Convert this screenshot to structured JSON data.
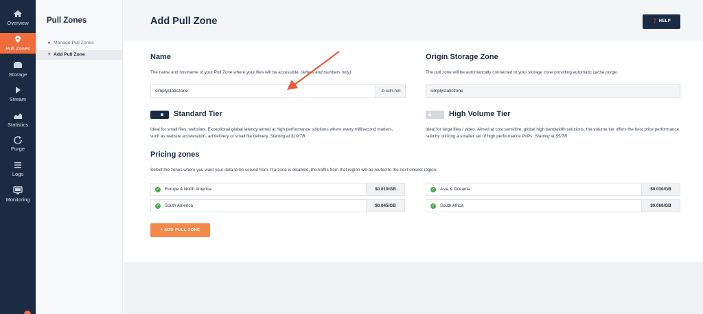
{
  "nav": {
    "items": [
      {
        "label": "Overview",
        "icon": "home-icon"
      },
      {
        "label": "Pull Zones",
        "icon": "map-pin-icon"
      },
      {
        "label": "Storage",
        "icon": "storage-icon"
      },
      {
        "label": "Stream",
        "icon": "play-icon"
      },
      {
        "label": "Statistics",
        "icon": "bar-chart-icon"
      },
      {
        "label": "Purge",
        "icon": "refresh-icon"
      },
      {
        "label": "Logs",
        "icon": "list-icon"
      },
      {
        "label": "Monitoring",
        "icon": "monitor-icon"
      }
    ],
    "active": "Pull Zones"
  },
  "sidebar": {
    "title": "Pull Zones",
    "items": [
      {
        "label": "Manage Pull Zones",
        "icon": "map-pin-icon"
      },
      {
        "label": "Add Pull Zone",
        "icon": "plus-icon"
      }
    ]
  },
  "header": {
    "title": "Add Pull Zone",
    "help_label": "HELP"
  },
  "name_section": {
    "heading": "Name",
    "description": "The name and hostname of your Pull Zone where your files will be accessible.",
    "description_hint": "(letters and numbers only)",
    "input_value": "simplystaticzone",
    "suffix": ".b-cdn.net"
  },
  "origin_section": {
    "heading": "Origin Storage Zone",
    "description": "The pull zone will be automatically connected to your storage zone providing automatic cache purge.",
    "input_value": "simplystaticzone"
  },
  "standard_tier": {
    "title": "Standard Tier",
    "enabled": true,
    "description": "Ideal for small files, websites. Exceptional global latency aimed at high performance solutions where every millisecond matters, such as website acceleration, ad delivery or small file delivery.",
    "price_note": "Starting at $10/TB"
  },
  "volume_tier": {
    "title": "High Volume Tier",
    "enabled": false,
    "description": "Ideal for large files / video. Aimed at cost sensitive, global high bandwidth solutions, the volume tier offers the best price performance ratio by utilizing a smaller set of high performance PoPs.",
    "price_note": "Starting at $5/TB"
  },
  "pricing": {
    "heading": "Pricing zones",
    "description": "Select the zones where you want your data to be served from. If a zone is disabled, the traffic from that region will be routed to the next closest region.",
    "zones": [
      {
        "name": "Europe & North America",
        "price": "$0.010/GB"
      },
      {
        "name": "South America",
        "price": "$0.045/GB"
      },
      {
        "name": "Asia & Oceania",
        "price": "$0.030/GB"
      },
      {
        "name": "South Africa",
        "price": "$0.060/GB"
      }
    ]
  },
  "actions": {
    "add_label": "+ ADD PULL ZONE"
  },
  "colors": {
    "nav_bg": "#1b2b44",
    "accent": "#f26b3a",
    "add_button": "#f58a4b",
    "check_green": "#4caf50",
    "arrow": "#ee5a36"
  }
}
